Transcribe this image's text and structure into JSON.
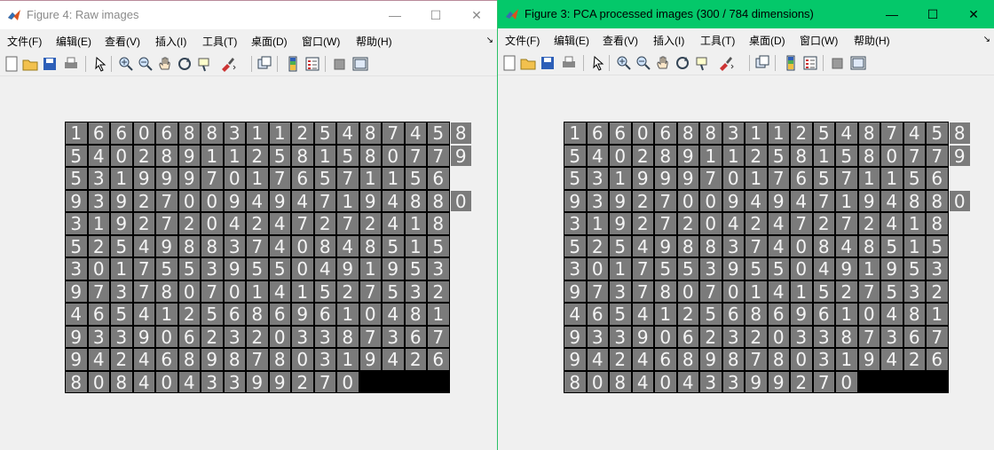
{
  "windows": [
    {
      "id": "left",
      "title": "Figure 4: Raw images",
      "menu": [
        "文件(F)",
        "编辑(E)",
        "查看(V)",
        "插入(I)",
        "工具(T)",
        "桌面(D)",
        "窗口(W)",
        "帮助(H)"
      ],
      "digits": [
        "1660688311254874 58",
        "5402891125815807 79",
        "5319997017657115 6",
        "9392700949471948 80",
        "3192720424727241 8",
        "5254988374084851 5",
        "3017553955049195 3",
        "9737807014152753 2",
        "4654125686961048 1",
        "9339062320338736 7",
        "9424689878031942 6",
        "8084043399270"
      ]
    },
    {
      "id": "right",
      "title": "Figure 3: PCA processed images (300 / 784 dimensions)",
      "menu": [
        "文件(F)",
        "编辑(E)",
        "查看(V)",
        "插入(I)",
        "工具(T)",
        "桌面(D)",
        "窗口(W)",
        "帮助(H)"
      ],
      "digits": [
        "1660688311254874 58",
        "5402891125815807 79",
        "5319997017657115 6",
        "9392700949471948 80",
        "3192720424727241 8",
        "5254988374084851 5",
        "3017553955049195 3",
        "9737807014152753 2",
        "4654125686961048 1",
        "9339062320338736 7",
        "9424689878031942 6",
        "8084043399270"
      ]
    }
  ],
  "window_controls": {
    "minimize": "—",
    "maximize": "☐",
    "close": "✕"
  },
  "toolbar_icons": [
    "new-figure-icon",
    "open-icon",
    "save-icon",
    "print-icon",
    "pointer-icon",
    "zoom-in-icon",
    "zoom-out-icon",
    "pan-icon",
    "rotate-icon",
    "data-cursor-icon",
    "brush-icon",
    "link-icon",
    "colorbar-icon",
    "legend-icon",
    "hide-plot-tools-icon",
    "show-plot-tools-icon"
  ],
  "colors": {
    "right_titlebar": "#04c86a",
    "left_titlebar": "#ffffff",
    "cell_bg": "#7b7b7b",
    "panel_bg": "#000000"
  }
}
